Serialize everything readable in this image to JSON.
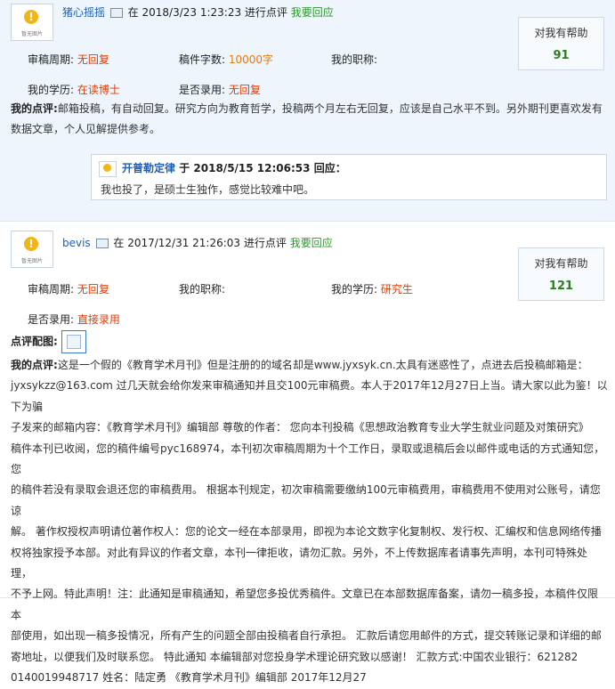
{
  "posts": [
    {
      "avatar_caption": "暂无图片",
      "author": "猪心摇摇",
      "at_label": "在",
      "datetime": "2018/3/23 1:23:23 进行点评",
      "reply_link": "我要回应",
      "help_label": "对我有帮助",
      "help_count": "91",
      "review_cycle_label": "审稿周期:",
      "review_cycle_value": "无回复",
      "word_count_label": "稿件字数:",
      "word_count_value": "10000字",
      "title_label": "我的职称:",
      "title_value": "",
      "education_label": "我的学历:",
      "education_value": "在读博士",
      "accepted_label": "是否录用:",
      "accepted_value": "无回复",
      "comment_label": "我的点评:",
      "comment_line1": "邮箱投稿，有自动回复。研究方向为教育哲学，投稿两个月左右无回复，应该是自己水平不到。另外期刊更喜欢发有",
      "comment_line2": "数据文章，个人见解提供参考。",
      "reply": {
        "author": "开普勒定律",
        "at_label": "于",
        "datetime": "2018/5/15 12:06:53",
        "action": "回应：",
        "text": "我也投了，是硕士生独作，感觉比较难中吧。"
      }
    },
    {
      "avatar_caption": "暂无图片",
      "author": "bevis",
      "at_label": "在",
      "datetime": "2017/12/31 21:26:03 进行点评",
      "reply_link": "我要回应",
      "help_label": "对我有帮助",
      "help_count": "121",
      "review_cycle_label": "审稿周期:",
      "review_cycle_value": "无回复",
      "title_label": "我的职称:",
      "title_value": "",
      "education_label": "我的学历:",
      "education_value": "研究生",
      "accepted_label": "是否录用:",
      "accepted_value": "直接录用",
      "image_label": "点评配图:",
      "comment_label": "我的点评:",
      "comment_lines": [
        "这是一个假的《教育学术月刊》但是注册的的域名却是www.jyxsyk.cn.太具有迷惑性了，点进去后投稿邮箱是：",
        "jyxsykzz@163.com 过几天就会给你发来审稿通知并且交100元审稿费。本人于2017年12月27日上当。请大家以此为鉴！以下为骗",
        "子发来的邮箱内容：《教育学术月刊》编辑部 尊敬的作者：  您向本刊投稿《思想政治教育专业大学生就业问题及对策研究》",
        "稿件本刊已收阅，您的稿件编号pyc168974，本刊初次审稿周期为十个工作日，录取或退稿后会以邮件或电话的方式通知您，您",
        "的稿件若没有录取会退还您的审稿费用。 根据本刊规定，初次审稿需要缴纳100元审稿费用，审稿费用不使用对公账号，请您谅",
        "解。 著作权授权声明请位著作权人：您的论文一经在本部录用，即视为本论文数字化复制权、发行权、汇编权和信息网络传播",
        "权将独家授予本部。对此有异议的作者文章，本刊一律拒收，请勿汇款。另外，不上传数据库者请事先声明，本刊可特殊处理，",
        "不予上网。特此声明！注：此通知是审稿通知，希望您多投优秀稿件。文章已在本部数据库备案，请勿一稿多投，本稿件仅限本",
        "部使用，如出现一稿多投情况，所有产生的问题全部由投稿者自行承担。 汇款后请您用邮件的方式，提交转账记录和详细的邮",
        "寄地址，以便我们及时联系您。 特此通知 本编辑部对您投身学术理论研究致以感谢！ 汇款方式:中国农业银行：621282",
        "0140019948717 姓名：陆定勇 《教育学术月刊》编辑部 2017年12月27"
      ]
    }
  ],
  "colors": {
    "link_blue": "#1f5fb6",
    "reply_green": "#279b27",
    "value_red": "#e23c00",
    "word_orange": "#e8780c",
    "help_count_green": "#2f7d1e",
    "post_bg_blue": "#eef5fd"
  },
  "icons": [
    "avatar-placeholder-icon",
    "message-icon",
    "image-thumbnail-icon"
  ]
}
